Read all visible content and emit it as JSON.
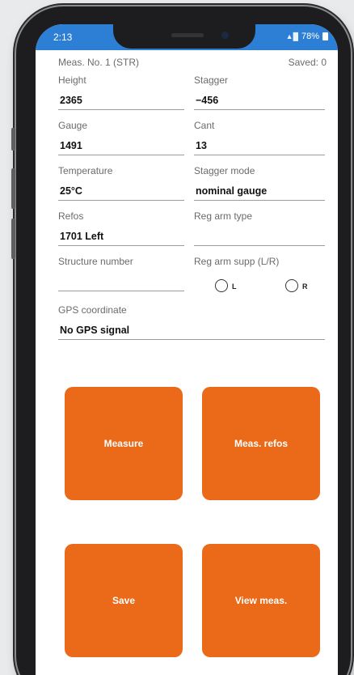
{
  "status_bar": {
    "time": "2:13",
    "battery": "78%"
  },
  "header": {
    "meas_no": "Meas. No. 1 (STR)",
    "saved": "Saved: 0"
  },
  "fields": {
    "height": {
      "label": "Height",
      "value": "2365"
    },
    "stagger": {
      "label": "Stagger",
      "value": "−456"
    },
    "gauge": {
      "label": "Gauge",
      "value": "1491"
    },
    "cant": {
      "label": "Cant",
      "value": "13"
    },
    "temperature": {
      "label": "Temperature",
      "value": "25°C"
    },
    "stagger_mode": {
      "label": "Stagger mode",
      "value": "nominal gauge"
    },
    "refos": {
      "label": "Refos",
      "value": "1701 Left"
    },
    "reg_arm_type": {
      "label": "Reg arm type",
      "value": ""
    },
    "structure_number": {
      "label": "Structure number",
      "value": ""
    },
    "reg_arm_supp": {
      "label": "Reg arm supp (L/R)",
      "option_left": "L",
      "option_right": "R"
    },
    "gps": {
      "label": "GPS coordinate",
      "value": "No GPS signal"
    }
  },
  "buttons": {
    "measure": "Measure",
    "meas_refos": "Meas. refos",
    "save": "Save",
    "view_meas": "View meas."
  },
  "colors": {
    "accent": "#ea6a19",
    "status_bar": "#2d7fd6"
  }
}
